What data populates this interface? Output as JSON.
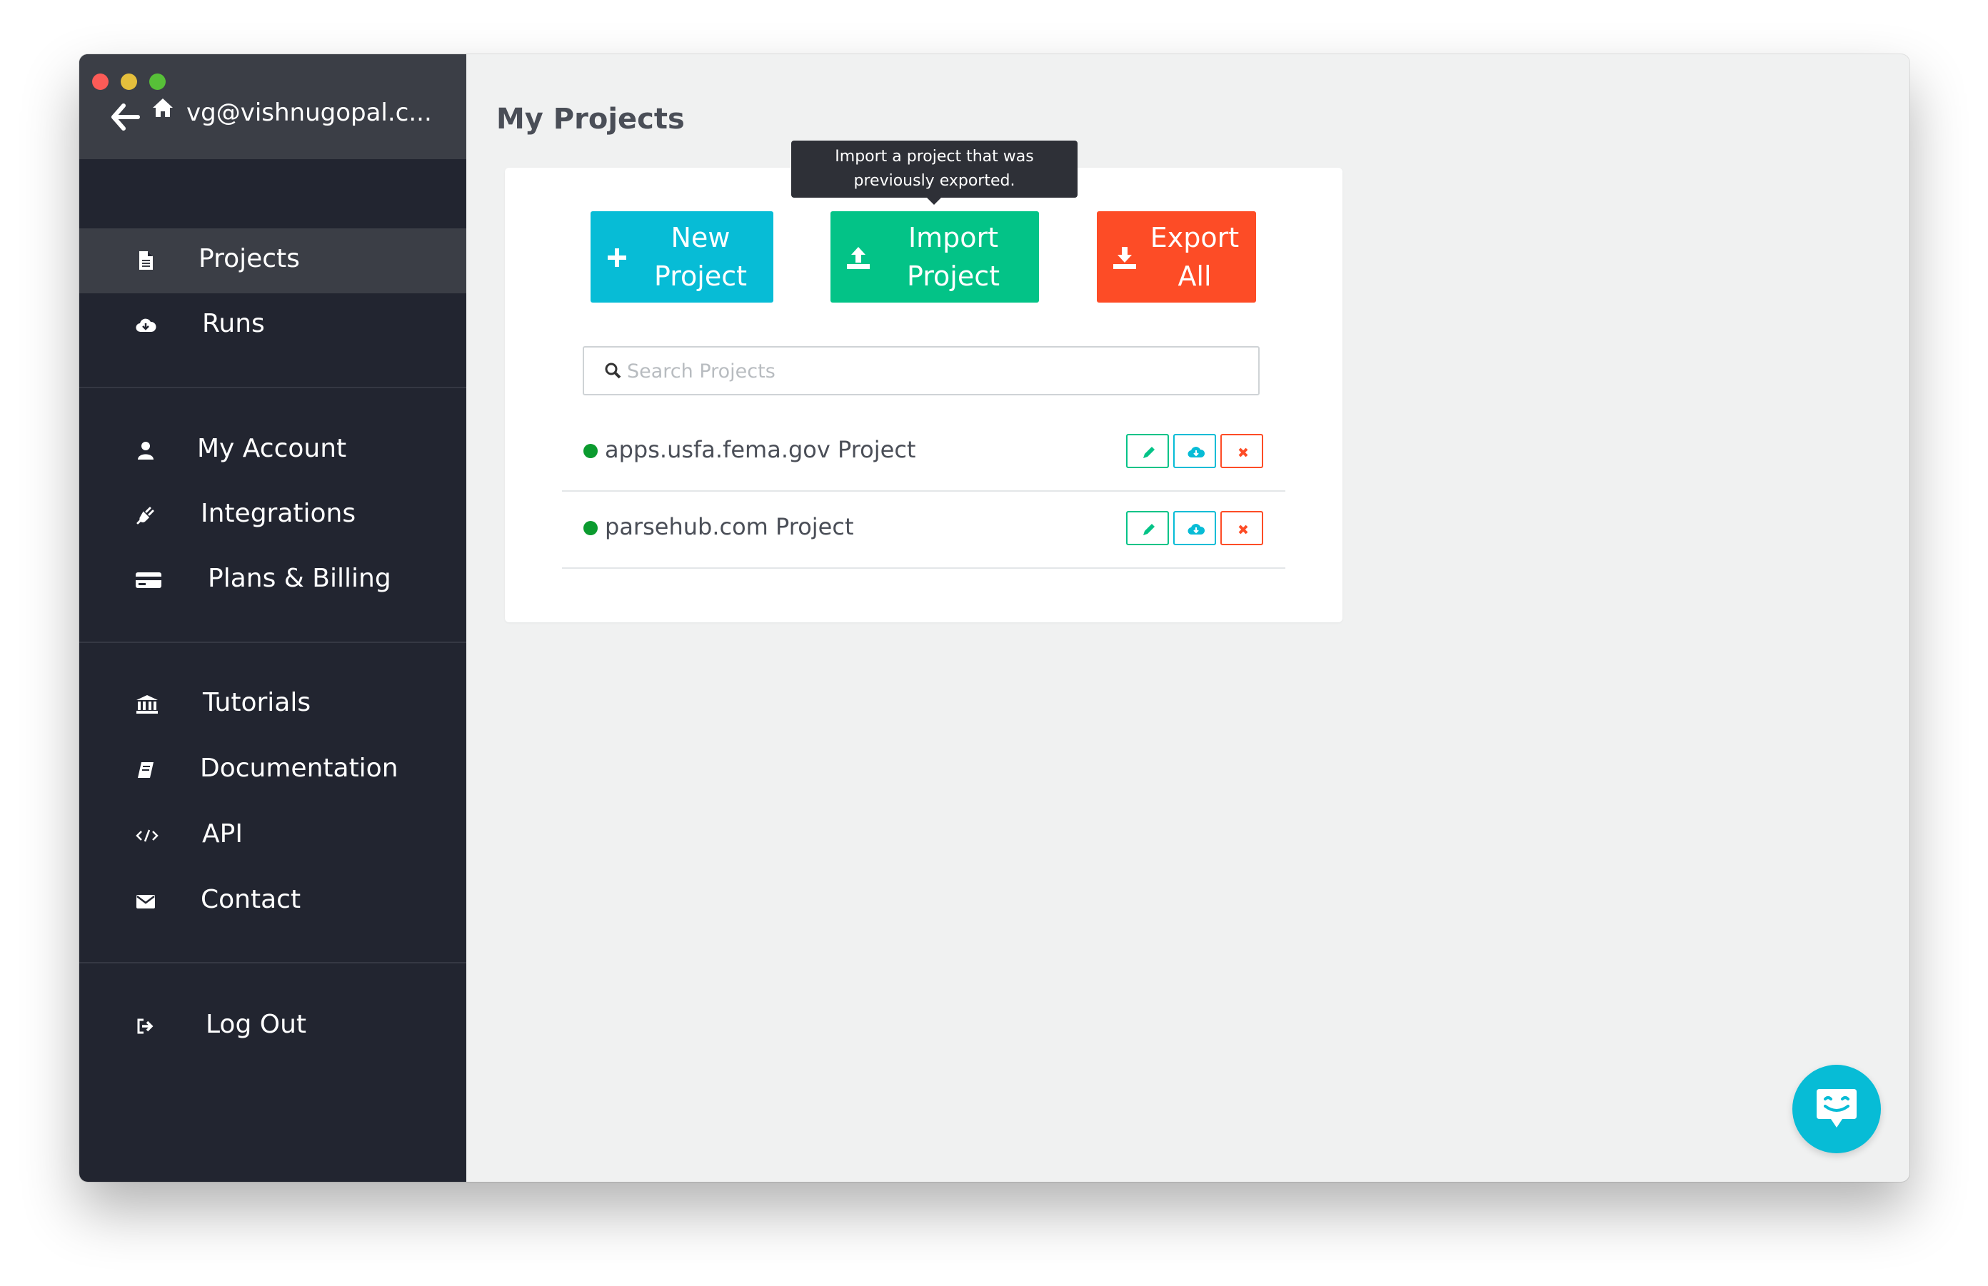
{
  "account": {
    "email": "vg@vishnugopal.c..."
  },
  "sidebar": {
    "groups": [
      [
        {
          "label": "Projects",
          "icon": "file-icon",
          "active": true
        },
        {
          "label": "Runs",
          "icon": "cloud-download-icon"
        }
      ],
      [
        {
          "label": "My Account",
          "icon": "user-icon"
        },
        {
          "label": "Integrations",
          "icon": "plug-icon"
        },
        {
          "label": "Plans & Billing",
          "icon": "credit-card-icon"
        }
      ],
      [
        {
          "label": "Tutorials",
          "icon": "bank-icon"
        },
        {
          "label": "Documentation",
          "icon": "book-icon"
        },
        {
          "label": "API",
          "icon": "code-icon"
        },
        {
          "label": "Contact",
          "icon": "envelope-icon"
        }
      ],
      [
        {
          "label": "Log Out",
          "icon": "sign-out-icon"
        }
      ]
    ]
  },
  "main": {
    "title": "My Projects",
    "actions": {
      "new_project": {
        "line1": "New",
        "line2": "Project"
      },
      "import_project": {
        "line1": "Import",
        "line2": "Project"
      },
      "export_all": {
        "line1": "Export",
        "line2": "All"
      }
    },
    "tooltip": {
      "line1": "Import a project that was",
      "line2": "previously exported."
    },
    "search": {
      "placeholder": "Search Projects",
      "value": ""
    },
    "projects": [
      {
        "name": "apps.usfa.fema.gov Project",
        "status": "ready"
      },
      {
        "name": "parsehub.com Project",
        "status": "ready"
      }
    ]
  },
  "colors": {
    "sidebar_bg": "#222530",
    "sidebar_active": "#3b3e46",
    "cyan": "#07bcd6",
    "green": "#03c387",
    "red_orange": "#fd4c26",
    "status_green": "#0b9b2f"
  }
}
